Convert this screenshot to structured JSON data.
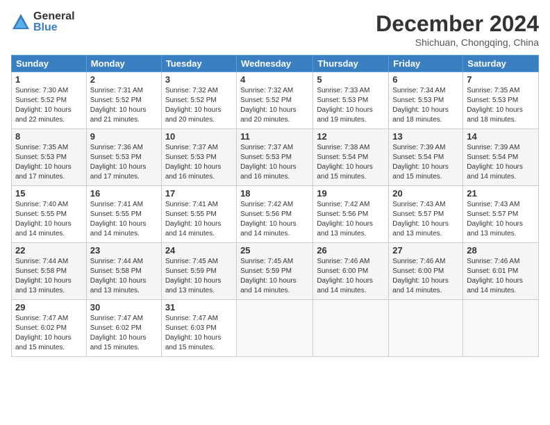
{
  "logo": {
    "general": "General",
    "blue": "Blue"
  },
  "title": "December 2024",
  "subtitle": "Shichuan, Chongqing, China",
  "days_header": [
    "Sunday",
    "Monday",
    "Tuesday",
    "Wednesday",
    "Thursday",
    "Friday",
    "Saturday"
  ],
  "weeks": [
    [
      {
        "day": "1",
        "info": "Sunrise: 7:30 AM\nSunset: 5:52 PM\nDaylight: 10 hours\nand 22 minutes."
      },
      {
        "day": "2",
        "info": "Sunrise: 7:31 AM\nSunset: 5:52 PM\nDaylight: 10 hours\nand 21 minutes."
      },
      {
        "day": "3",
        "info": "Sunrise: 7:32 AM\nSunset: 5:52 PM\nDaylight: 10 hours\nand 20 minutes."
      },
      {
        "day": "4",
        "info": "Sunrise: 7:32 AM\nSunset: 5:52 PM\nDaylight: 10 hours\nand 20 minutes."
      },
      {
        "day": "5",
        "info": "Sunrise: 7:33 AM\nSunset: 5:53 PM\nDaylight: 10 hours\nand 19 minutes."
      },
      {
        "day": "6",
        "info": "Sunrise: 7:34 AM\nSunset: 5:53 PM\nDaylight: 10 hours\nand 18 minutes."
      },
      {
        "day": "7",
        "info": "Sunrise: 7:35 AM\nSunset: 5:53 PM\nDaylight: 10 hours\nand 18 minutes."
      }
    ],
    [
      {
        "day": "8",
        "info": "Sunrise: 7:35 AM\nSunset: 5:53 PM\nDaylight: 10 hours\nand 17 minutes."
      },
      {
        "day": "9",
        "info": "Sunrise: 7:36 AM\nSunset: 5:53 PM\nDaylight: 10 hours\nand 17 minutes."
      },
      {
        "day": "10",
        "info": "Sunrise: 7:37 AM\nSunset: 5:53 PM\nDaylight: 10 hours\nand 16 minutes."
      },
      {
        "day": "11",
        "info": "Sunrise: 7:37 AM\nSunset: 5:53 PM\nDaylight: 10 hours\nand 16 minutes."
      },
      {
        "day": "12",
        "info": "Sunrise: 7:38 AM\nSunset: 5:54 PM\nDaylight: 10 hours\nand 15 minutes."
      },
      {
        "day": "13",
        "info": "Sunrise: 7:39 AM\nSunset: 5:54 PM\nDaylight: 10 hours\nand 15 minutes."
      },
      {
        "day": "14",
        "info": "Sunrise: 7:39 AM\nSunset: 5:54 PM\nDaylight: 10 hours\nand 14 minutes."
      }
    ],
    [
      {
        "day": "15",
        "info": "Sunrise: 7:40 AM\nSunset: 5:55 PM\nDaylight: 10 hours\nand 14 minutes."
      },
      {
        "day": "16",
        "info": "Sunrise: 7:41 AM\nSunset: 5:55 PM\nDaylight: 10 hours\nand 14 minutes."
      },
      {
        "day": "17",
        "info": "Sunrise: 7:41 AM\nSunset: 5:55 PM\nDaylight: 10 hours\nand 14 minutes."
      },
      {
        "day": "18",
        "info": "Sunrise: 7:42 AM\nSunset: 5:56 PM\nDaylight: 10 hours\nand 14 minutes."
      },
      {
        "day": "19",
        "info": "Sunrise: 7:42 AM\nSunset: 5:56 PM\nDaylight: 10 hours\nand 13 minutes."
      },
      {
        "day": "20",
        "info": "Sunrise: 7:43 AM\nSunset: 5:57 PM\nDaylight: 10 hours\nand 13 minutes."
      },
      {
        "day": "21",
        "info": "Sunrise: 7:43 AM\nSunset: 5:57 PM\nDaylight: 10 hours\nand 13 minutes."
      }
    ],
    [
      {
        "day": "22",
        "info": "Sunrise: 7:44 AM\nSunset: 5:58 PM\nDaylight: 10 hours\nand 13 minutes."
      },
      {
        "day": "23",
        "info": "Sunrise: 7:44 AM\nSunset: 5:58 PM\nDaylight: 10 hours\nand 13 minutes."
      },
      {
        "day": "24",
        "info": "Sunrise: 7:45 AM\nSunset: 5:59 PM\nDaylight: 10 hours\nand 13 minutes."
      },
      {
        "day": "25",
        "info": "Sunrise: 7:45 AM\nSunset: 5:59 PM\nDaylight: 10 hours\nand 14 minutes."
      },
      {
        "day": "26",
        "info": "Sunrise: 7:46 AM\nSunset: 6:00 PM\nDaylight: 10 hours\nand 14 minutes."
      },
      {
        "day": "27",
        "info": "Sunrise: 7:46 AM\nSunset: 6:00 PM\nDaylight: 10 hours\nand 14 minutes."
      },
      {
        "day": "28",
        "info": "Sunrise: 7:46 AM\nSunset: 6:01 PM\nDaylight: 10 hours\nand 14 minutes."
      }
    ],
    [
      {
        "day": "29",
        "info": "Sunrise: 7:47 AM\nSunset: 6:02 PM\nDaylight: 10 hours\nand 15 minutes."
      },
      {
        "day": "30",
        "info": "Sunrise: 7:47 AM\nSunset: 6:02 PM\nDaylight: 10 hours\nand 15 minutes."
      },
      {
        "day": "31",
        "info": "Sunrise: 7:47 AM\nSunset: 6:03 PM\nDaylight: 10 hours\nand 15 minutes."
      },
      {
        "day": "",
        "info": ""
      },
      {
        "day": "",
        "info": ""
      },
      {
        "day": "",
        "info": ""
      },
      {
        "day": "",
        "info": ""
      }
    ]
  ]
}
